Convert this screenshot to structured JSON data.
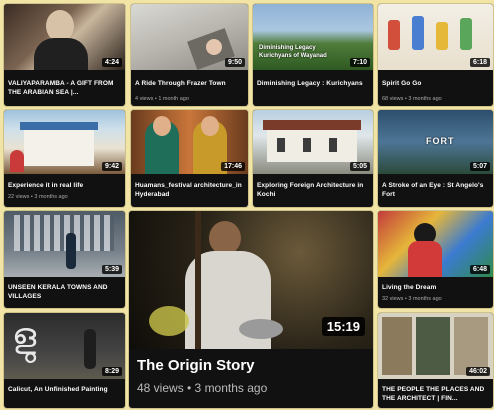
{
  "videos": [
    {
      "title": "VALIYAPARAMBA - A GIFT FROM THE ARABIAN SEA |...",
      "meta": "",
      "duration": "4:24"
    },
    {
      "title": "A Ride Through Frazer Town",
      "meta": "4 views • 1 month ago",
      "duration": "9:50"
    },
    {
      "title": "Diminishing Legacy : Kurichyans",
      "meta": "",
      "duration": "7:10",
      "overlay": "Diminishing Legacy\nKurichyans of Wayanad"
    },
    {
      "title": "Spirit Go Go",
      "meta": "68 views • 3 months ago",
      "duration": "6:18"
    },
    {
      "title": "Experience it in real life",
      "meta": "22 views • 3 months ago",
      "duration": "9:42"
    },
    {
      "title": "Huamans_festival architecture_in Hyderabad",
      "meta": "",
      "duration": "17:46"
    },
    {
      "title": "Exploring Foreign Architecture in Kochi",
      "meta": "",
      "duration": "5:05"
    },
    {
      "title": "A Stroke of an Eye : St Angelo's Fort",
      "meta": "",
      "duration": "5:07",
      "overlay": "FORT"
    },
    {
      "title": "UNSEEN KERALA TOWNS AND VILLAGES",
      "meta": "",
      "duration": "5:39"
    },
    {
      "title": "The Origin Story",
      "meta": "48 views • 3 months ago",
      "duration": "15:19"
    },
    {
      "title": "Living the Dream",
      "meta": "32 views • 3 months ago",
      "duration": "6:48"
    },
    {
      "title": "Calicut, An Unfinished Painting",
      "meta": "",
      "duration": "8:29"
    },
    {
      "title": "THE PEOPLE THE PLACES AND THE ARCHITECT | FIN...",
      "meta": "",
      "duration": "46:02"
    }
  ],
  "colors": {
    "background": "#f2e4a4",
    "card": "#111111"
  }
}
